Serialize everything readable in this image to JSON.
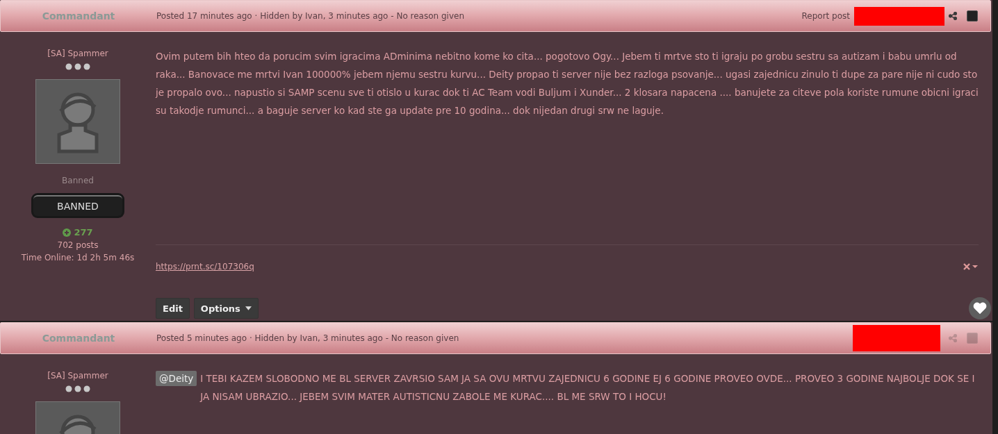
{
  "posts": [
    {
      "author": "Commandant",
      "meta": "Posted 17 minutes ago · Hidden by Ivan, 3 minutes ago - No reason given",
      "report": "Report post",
      "tools_disabled": false,
      "user": {
        "title": "[SA] Spammer",
        "group": "Banned",
        "badge": "BANNED",
        "reputation": "277",
        "posts": "702 posts",
        "online": "Time Online: 1d 2h 5m 46s"
      },
      "body": "Ovim putem bih hteo da porucim svim igracima ADminima nebitno kome ko cita... pogotovo Ogy... Jebem ti mrtve sto ti igraju po grobu sestru sa autizam i babu umrlu od raka... Banovace me mrtvi Ivan 100000% jebem njemu sestru kurvu... Deity propao ti server nije bez razloga psovanje... ugasi zajednicu zinulo ti dupe za pare nije ni cudo sto je propalo ovo... napustio si SAMP scenu sve ti otislo u kurac dok ti AC Team vodi Buljum i Xunder... 2 klosara napacena .... banujete za citeve pola koriste rumune obicni igraci su takodje rumunci... a baguje server ko kad ste ga update pre 10 godina... dok nijedan drugi srw ne laguje.",
      "signature": "https://prnt.sc/107306q",
      "buttons": [
        "Edit",
        "Options"
      ]
    },
    {
      "author": "Commandant",
      "meta": "Posted 5 minutes ago · Hidden by Ivan, 3 minutes ago - No reason given",
      "tools_disabled": true,
      "user": {
        "title": "[SA] Spammer"
      },
      "mention": "@Deity",
      "body": "I TEBI KAZEM SLOBODNO ME BL SERVER ZAVRSIO SAM JA SA OVU MRTVU ZAJEDNICU 6 GODINE EJ 6 GODINE PROVEO OVDE... PROVEO 3 GODINE NAJBOLJE DOK SE I JA NISAM UBRAZIO... JEBEM SVIM MATER AUTISTICNU ZABOLE ME KURAC.... BL ME SRW TO I HOCU!"
    }
  ]
}
